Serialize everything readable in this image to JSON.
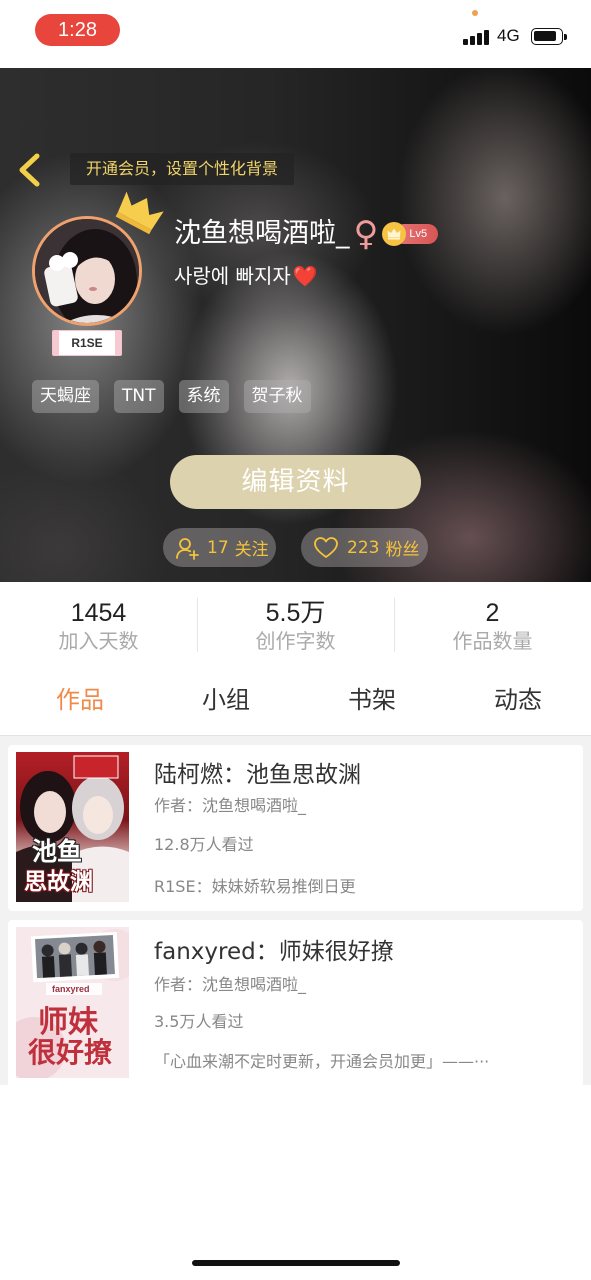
{
  "status_bar": {
    "time": "1:28",
    "network": "4G",
    "icons": [
      "signal-icon",
      "battery-icon"
    ]
  },
  "header": {
    "back_icon": "chevron-left-icon",
    "vip_banner": "开通会员，设置个性化背景",
    "username": "沈鱼想喝酒啦_",
    "gender_symbol": "♀",
    "level": "Lv5",
    "bio": {
      "text": "사랑에 빠지자",
      "emoji": "❤️"
    },
    "avatar_badge": "R1SE",
    "tags": [
      "天蝎座",
      "TNT",
      "系统",
      "贺子秋"
    ],
    "edit_button": "编辑资料",
    "following": {
      "count": "17",
      "label": "关注",
      "icon": "user-plus-icon"
    },
    "followers": {
      "count": "223",
      "label": "粉丝",
      "icon": "heart-icon"
    }
  },
  "stats": [
    {
      "value": "1454",
      "label": "加入天数"
    },
    {
      "value": "5.5万",
      "label": "创作字数"
    },
    {
      "value": "2",
      "label": "作品数量"
    }
  ],
  "tabs": [
    {
      "label": "作品",
      "active": true
    },
    {
      "label": "小组",
      "active": false
    },
    {
      "label": "书架",
      "active": false
    },
    {
      "label": "动态",
      "active": false
    }
  ],
  "works": [
    {
      "title": "陆柯燃：池鱼思故渊",
      "author": "作者：沈鱼想喝酒啦_",
      "views": "12.8万人看过",
      "note": "R1SE：妹妹娇软易推倒日更",
      "cover_text": [
        "池鱼",
        "思故渊"
      ]
    },
    {
      "title": "fanxyred：师妹很好撩",
      "author": "作者：沈鱼想喝酒啦_",
      "views": "3.5万人看过",
      "note": "「心血来潮不定时更新，开通会员加更」——···",
      "cover_text": [
        "fanxyred",
        "师妹",
        "很好撩"
      ]
    }
  ],
  "colors": {
    "accent": "#f08a4b",
    "gold": "#f5c33b",
    "vip_text": "#f0d36a",
    "edit_button": "#ddd2ae",
    "time_pill": "#e8453c",
    "gender": "#f09a9a"
  }
}
